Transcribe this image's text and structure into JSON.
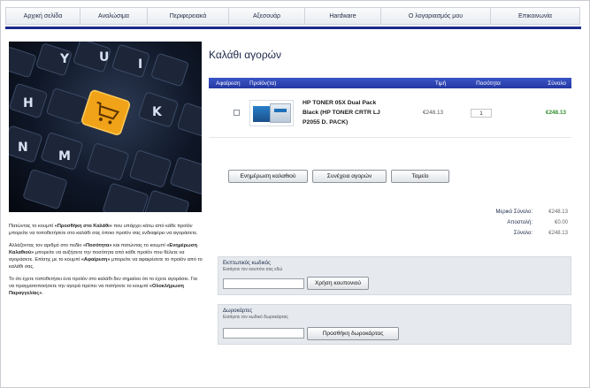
{
  "nav": {
    "items": [
      {
        "label": "Αρχική σελίδα"
      },
      {
        "label": "Αναλώσιμα"
      },
      {
        "label": "Περιφερειακά"
      },
      {
        "label": "Αξεσουάρ"
      },
      {
        "label": "Hardware"
      },
      {
        "label": "Ο λογαριασμός μου"
      },
      {
        "label": "Επικοινωνία"
      }
    ]
  },
  "page": {
    "title": "Καλάθι αγορών"
  },
  "cart": {
    "headers": {
      "remove": "Αφαίρεση",
      "product": "Προϊόν(τα)",
      "price": "Τιμή",
      "qty": "Ποσότητα",
      "total": "Σύνολο"
    },
    "items": [
      {
        "name_line1": "HP TONER 05X Dual Pack",
        "name_line2": "Black (HP TONER CRTR LJ",
        "name_line3": "P2055 D. PACK)",
        "price": "€248.13",
        "qty": "1",
        "total": "€248.13"
      }
    ]
  },
  "buttons": {
    "update": "Ενημέρωση καλαθιού",
    "continue": "Συνέχεια αγορών",
    "checkout": "Ταμείο"
  },
  "summary": {
    "subtotal_label": "Μερικό Σύνολο:",
    "subtotal_value": "€248.13",
    "shipping_label": "Αποστολή:",
    "shipping_value": "€0.00",
    "total_label": "Σύνολο:",
    "total_value": "€248.13"
  },
  "coupon": {
    "title": "Εκπτωτικός κωδικός",
    "hint": "Εισάγετε τον κουπόνι σας εδώ",
    "value": "",
    "button": "Χρήση κουπονιού"
  },
  "giftcard": {
    "title": "Δωροκάρτες",
    "hint": "Εισάγετε τον κωδικό δωροκάρτας",
    "value": "",
    "button": "Προσθήκη δωροκάρτας"
  },
  "help": {
    "p1_a": "Πατώντας το κουμπί ",
    "p1_b": "«Προσθήκη στο Καλάθι»",
    "p1_c": " που υπάρχει κάτω από κάθε προϊόν μπορείτε να τοποθετήσετε στο καλάθι σας όποιο προϊόν σας ενδιαφέρει να αγοράσετε.",
    "p2_a": "Αλλάζοντας τον αριθμό στο πεδίο ",
    "p2_b": "«Ποσότητα»",
    "p2_c": " και πατώντας το κουμπί ",
    "p2_d": "«Ενημέρωση Καλαθιού»",
    "p2_e": " μπορείτε να αυξήσετε την ποσότητα από κάθε προϊόν που θέλετε να αγοράσετε. Επίσης με το κουμπί ",
    "p2_f": "«Αφαίρεση»",
    "p2_g": " μπορείτε να αφαιρέσετε το προϊόν από το καλάθι σας.",
    "p3_a": "Το ότι έχετε τοποθετήσει ένα προϊόν στο καλάθι δεν σημαίνει ότι το έχετε αγοράσει. Για να πραγματοποιήσετε την αγορά πρέπει να πατήσετε το κουμπί ",
    "p3_b": "«Ολοκλήρωση Παραγγελίας»",
    "p3_c": "."
  },
  "colors": {
    "accent": "#1a2a8a",
    "header_blue": "#2f48b8",
    "total_green": "#2f8f2f",
    "key_orange": "#f0a318"
  },
  "icons": {
    "hero": "keyboard-cart-key-image",
    "thumb": "toner-product-image"
  }
}
